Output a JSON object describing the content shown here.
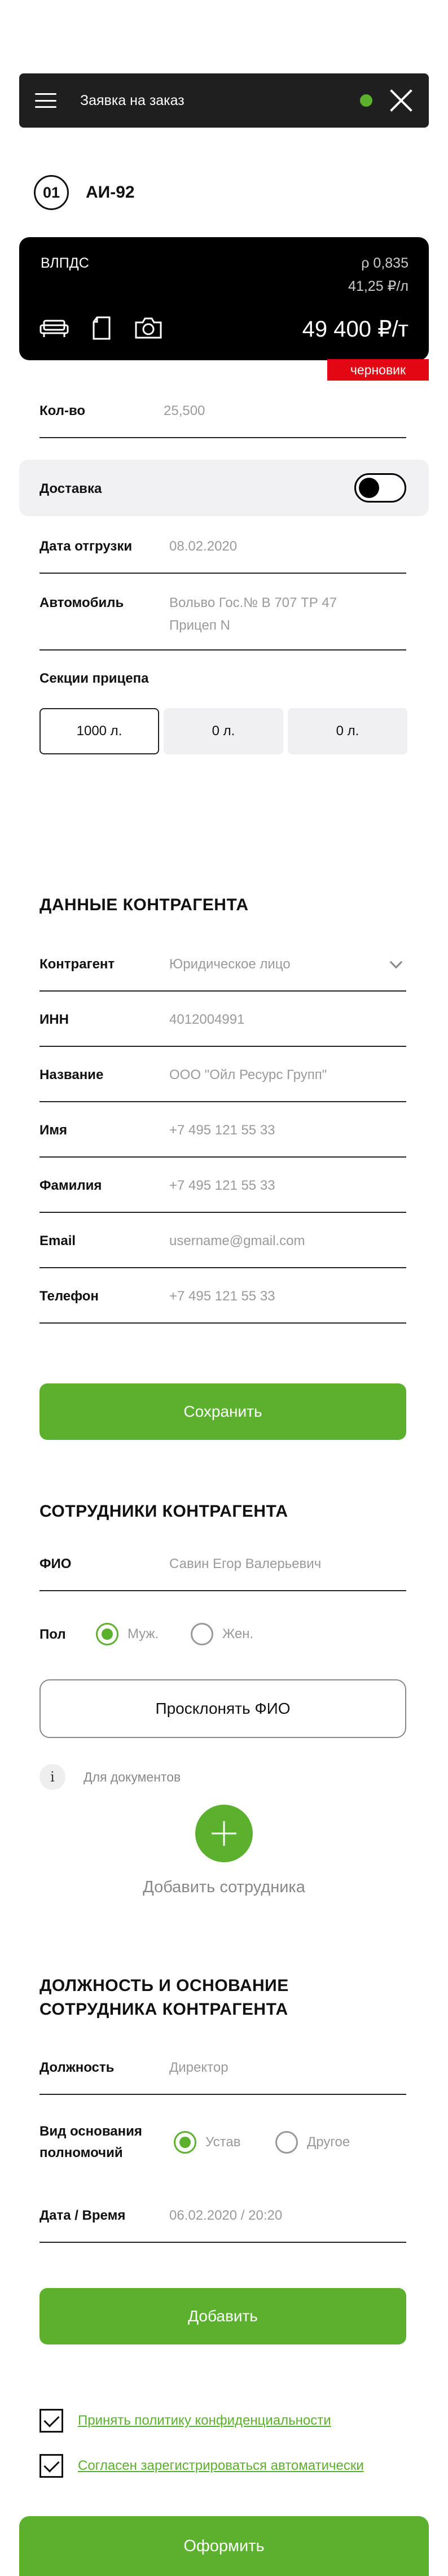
{
  "header": {
    "title": "Заявка на заказ",
    "menu_icon": "hamburger-icon",
    "close_icon": "close-icon",
    "status_color": "#5bb12e"
  },
  "fuel": {
    "number": "01",
    "name": "АИ-92"
  },
  "card": {
    "supplier": "ВЛПДС",
    "price_rho": "ρ 0,835",
    "price_per_liter": "41,25 ₽/л",
    "total": "49 400 ₽/т",
    "icons": [
      "sofa-icon",
      "document-icon",
      "camera-icon"
    ],
    "badge": "черновик"
  },
  "order": {
    "qty_label": "Кол-во",
    "qty_value": "25,500",
    "delivery_label": "Доставка",
    "ship_date_label": "Дата отгрузки",
    "ship_date_value": "08.02.2020",
    "car_label": "Автомобиль",
    "car_value_1": "Вольво Гос.№ В 707 ТР 47",
    "car_value_2": "Прицеп N",
    "sections_label": "Секции прицепа",
    "sections": [
      "1000 л.",
      "0 л.",
      "0 л."
    ]
  },
  "counterparty": {
    "heading": "ДАННЫЕ КОНТРАГЕНТА",
    "fields": [
      {
        "label": "Контрагент",
        "value": "Юридическое лицо"
      },
      {
        "label": "ИНН",
        "value": "4012004991"
      },
      {
        "label": "Название",
        "value": "ООО \"Ойл Ресурс Групп\""
      },
      {
        "label": "Имя",
        "value": "+7 495 121 55 33"
      },
      {
        "label": "Фамилия",
        "value": "+7 495 121 55 33"
      },
      {
        "label": "Email",
        "value": "username@gmail.com"
      },
      {
        "label": "Телефон",
        "value": "+7 495 121 55 33"
      }
    ],
    "save_button": "Сохранить"
  },
  "employees": {
    "heading": "СОТРУДНИКИ КОНТРАГЕНТА",
    "fio_label": "ФИО",
    "fio_value": "Савин Егор Валерьевич",
    "gender_label": "Пол",
    "gender_male": "Муж.",
    "gender_female": "Жен.",
    "decline_button": "Просклонять ФИО",
    "info_text": "Для документов",
    "add_employee": "Добавить сотрудника"
  },
  "position": {
    "heading_1": "ДОЛЖНОСТЬ И ОСНОВАНИЕ",
    "heading_2": "СОТРУДНИКА КОНТРАГЕНТА",
    "position_label": "Должность",
    "position_value": "Директор",
    "basis_label_1": "Вид основания",
    "basis_label_2": "полномочий",
    "basis_option_1": "Устав",
    "basis_option_2": "Другое",
    "datetime_label": "Дата / Время",
    "datetime_value": "06.02.2020 / 20:20",
    "add_button": "Добавить"
  },
  "agreements": {
    "privacy": "Принять политику конфиденциальности",
    "auto_register": "Согласен зарегистрироваться автоматически"
  },
  "submit_button": "Оформить"
}
